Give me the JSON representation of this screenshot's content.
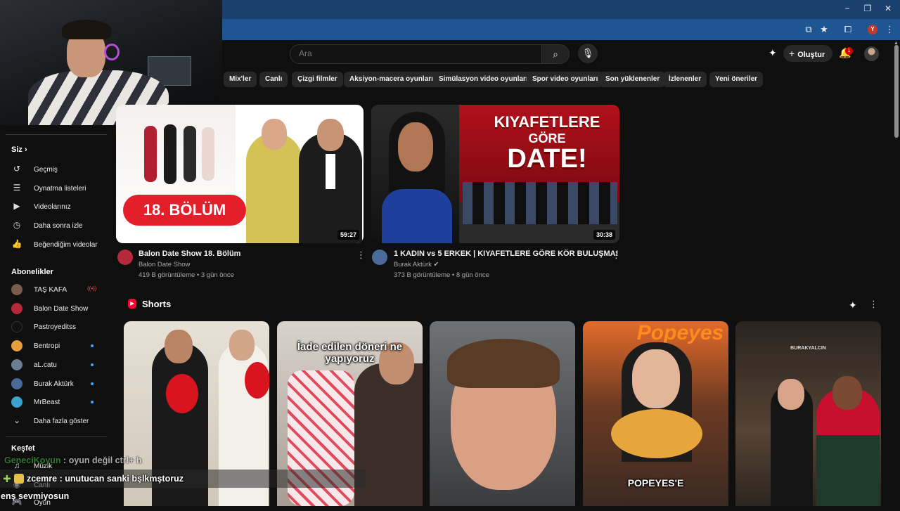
{
  "colors": {
    "accent": "#ff0033",
    "background": "#0f0f0f",
    "chip": "#272727",
    "chrome_blue": "#1e5694"
  },
  "browser": {
    "controls": {
      "minimize": "−",
      "restore": "❐",
      "close": "✕"
    },
    "profile_initial": "Y"
  },
  "masthead": {
    "search_placeholder": "Ara",
    "create_label": "Oluştur",
    "notification_count": "1"
  },
  "chips": [
    "Mix'ler",
    "Canlı",
    "Çizgi filmler",
    "Aksiyon-macera oyunları",
    "Simülasyon video oyunları",
    "Spor video oyunları",
    "Son yüklenenler",
    "İzlenenler",
    "Yeni öneriler"
  ],
  "sidebar": {
    "you_header": "Siz",
    "you_items": [
      {
        "icon": "history-icon",
        "label": "Geçmiş"
      },
      {
        "icon": "playlist-icon",
        "label": "Oynatma listeleri"
      },
      {
        "icon": "your-videos-icon",
        "label": "Videolarınız"
      },
      {
        "icon": "watch-later-icon",
        "label": "Daha sonra izle"
      },
      {
        "icon": "like-icon",
        "label": "Beğendiğim videolar"
      }
    ],
    "subscriptions_header": "Abonelikler",
    "subscriptions": [
      {
        "label": "TAŞ KAFA",
        "status": "live",
        "color": "#7a5c4a"
      },
      {
        "label": "Balon Date Show",
        "status": "none",
        "color": "#b52a3a"
      },
      {
        "label": "Pastroyeditss",
        "status": "none",
        "color": "#111111"
      },
      {
        "label": "Bentropi",
        "status": "new",
        "color": "#e3a03c"
      },
      {
        "label": "aL.catu",
        "status": "new",
        "color": "#6b7f95"
      },
      {
        "label": "Burak Aktürk",
        "status": "new",
        "color": "#4a6a9a"
      },
      {
        "label": "MrBeast",
        "status": "new",
        "color": "#3aa3c9"
      }
    ],
    "show_more_label": "Daha fazla göster",
    "explore_header": "Keşfet",
    "explore_items": [
      {
        "label": "Müzik"
      },
      {
        "label": "Canlı"
      },
      {
        "label": "Oyun"
      }
    ]
  },
  "videos": [
    {
      "title": "Balon Date Show 18. Bölüm",
      "channel": "Balon Date Show",
      "meta": "419 B görüntüleme • 3 gün önce",
      "duration": "59:27",
      "thumb_text": "18. BÖLÜM"
    },
    {
      "title": "1 KADIN vs 5 ERKEK | KIYAFETLERE GÖRE KÖR BULUŞMA!",
      "channel": "Burak Aktürk",
      "meta": "373 B görüntüleme • 8 gün önce",
      "duration": "30:38",
      "thumb_text_1": "KIYAFETLERE",
      "thumb_text_2": "GÖRE",
      "thumb_text_3": "DATE!"
    }
  ],
  "shorts": {
    "header": "Shorts",
    "items": [
      {
        "overlay": ""
      },
      {
        "overlay": "İade edilen döneri ne yapıyoruz"
      },
      {
        "overlay": ""
      },
      {
        "overlay": "POPEYES'E",
        "sign": "Popeyes"
      },
      {
        "overlay": "",
        "watermark": "BURAKYALCIN"
      }
    ]
  },
  "chat": [
    {
      "user": "GeneciKoyun",
      "message": "oyun değil ctrl+ h",
      "color": "#3c9b3c"
    },
    {
      "user": "zcemre",
      "message": "unutucan sanki bşlkmştoruz",
      "color": "#ffffff"
    },
    {
      "user": "",
      "message": "enş sevmiyosun",
      "color": "#ffffff"
    }
  ]
}
